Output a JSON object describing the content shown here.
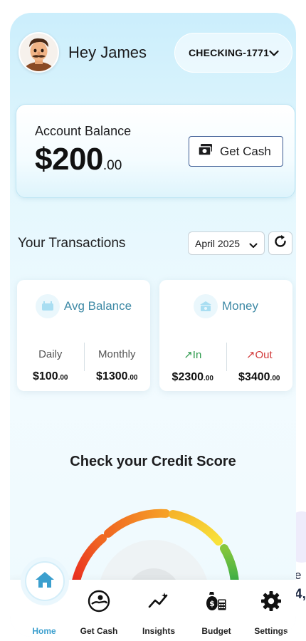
{
  "header": {
    "greeting": "Hey James",
    "account": "CHECKING-1771"
  },
  "balance": {
    "label": "Account Balance",
    "amount": "$200",
    "cents": ".00",
    "get_cash_label": "Get Cash"
  },
  "transactions": {
    "title": "Your Transactions",
    "month": "April 2025"
  },
  "avg_balance": {
    "title": "Avg Balance",
    "daily_label": "Daily",
    "daily_value": "$100",
    "daily_cents": ".00",
    "monthly_label": "Monthly",
    "monthly_value": "$1300",
    "monthly_cents": ".00"
  },
  "money": {
    "title": "Money",
    "in_label": "In",
    "in_value": "$2300",
    "in_cents": ".00",
    "out_label": "Out",
    "out_value": "$3400",
    "out_cents": ".00"
  },
  "credit": {
    "title": "Check your Credit Score"
  },
  "nav": {
    "home": "Home",
    "get_cash": "Get Cash",
    "insights": "Insights",
    "budget": "Budget",
    "settings": "Settings"
  },
  "edge_fragment": {
    "line1": "e",
    "line2": "4,"
  },
  "colors": {
    "accent": "#3b9fce",
    "in": "#2e9a4d",
    "out": "#d23b3b",
    "button_border": "#3a5a93"
  }
}
